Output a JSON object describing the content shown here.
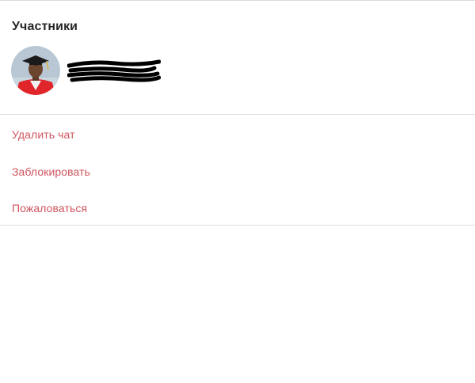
{
  "details": {
    "participants_title": "Участники",
    "participant": {
      "name": "",
      "avatar_icon": "graduate-avatar-icon"
    },
    "actions": {
      "delete_chat": "Удалить чат",
      "block": "Заблокировать",
      "report": "Пожаловаться"
    }
  },
  "colors": {
    "danger": "#d0555f",
    "text": "#262626",
    "divider": "#dbdbdb"
  }
}
